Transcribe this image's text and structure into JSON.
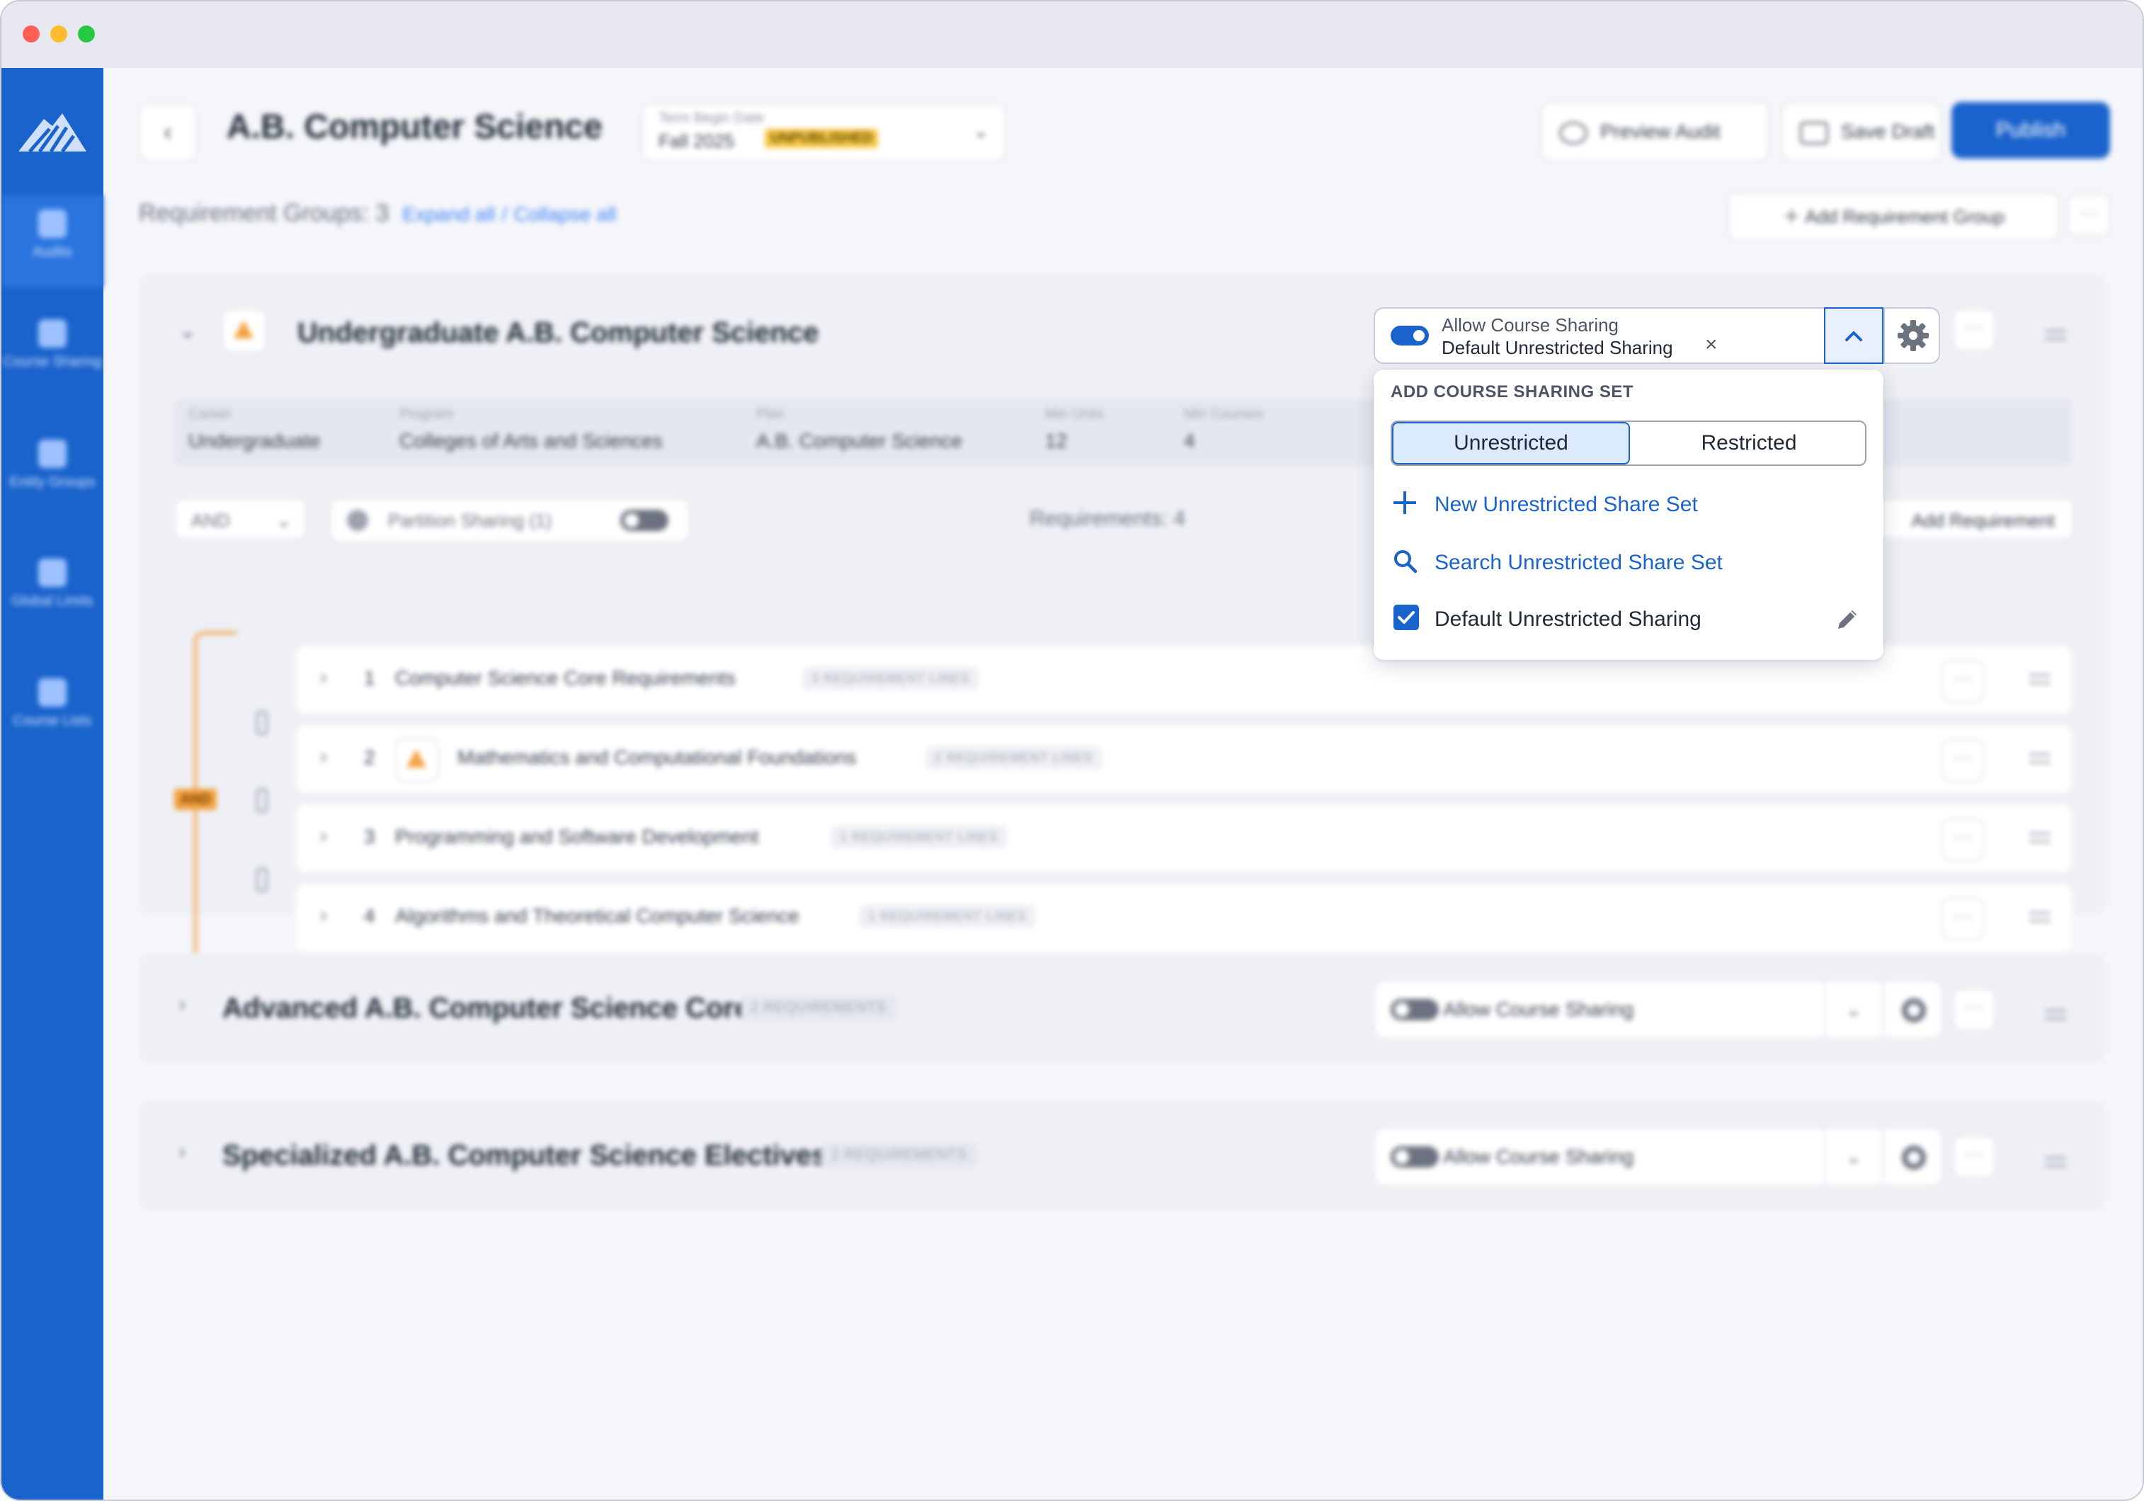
{
  "colors": {
    "brand": "#1a63cc",
    "accent_orange": "#f4a340",
    "badge_yellow": "#f7c948",
    "link": "#1a63cc"
  },
  "sidebar": {
    "items": [
      {
        "label": "Audits",
        "icon": "audit-icon"
      },
      {
        "label": "Course Sharing",
        "icon": "share-icon"
      },
      {
        "label": "Entity Groups",
        "icon": "folder-icon"
      },
      {
        "label": "Global Limits",
        "icon": "lock-icon"
      },
      {
        "label": "Course Lists",
        "icon": "list-icon"
      }
    ]
  },
  "header": {
    "title": "A.B. Computer Science",
    "term_label": "Term Begin Date",
    "term_value": "Fall 2025",
    "term_badge": "UNPUBLISHED",
    "preview_label": "Preview Audit",
    "save_label": "Save Draft",
    "publish_label": "Publish"
  },
  "groups_bar": {
    "count_text": "Requirement Groups: 3",
    "expand_all": "Expand all",
    "separator": "/",
    "collapse_all": "Collapse all",
    "add_group_label": "Add Requirement Group"
  },
  "group1": {
    "title": "Undergraduate A.B. Computer Science",
    "info": [
      {
        "label": "Career",
        "value": "Undergraduate"
      },
      {
        "label": "Program",
        "value": "Colleges of Arts and Sciences"
      },
      {
        "label": "Plan",
        "value": "A.B. Computer Science"
      },
      {
        "label": "Min Units",
        "value": "12"
      },
      {
        "label": "Min Courses",
        "value": "4"
      }
    ],
    "logic_value": "AND",
    "partition_label": "Partition Sharing (1)",
    "requirements_count": "Requirements: 4",
    "add_requirement": "Add Requirement",
    "and_pill": "AND",
    "requirements": [
      {
        "num": "1",
        "name": "Computer Science Core Requirements",
        "lines": "3 REQUIREMENT LINES"
      },
      {
        "num": "2",
        "name": "Mathematics and Computational Foundations",
        "lines": "2 REQUIREMENT LINES"
      },
      {
        "num": "3",
        "name": "Programming and Software Development",
        "lines": "1 REQUIREMENT LINES"
      },
      {
        "num": "4",
        "name": "Algorithms and Theoretical Computer Science",
        "lines": "1 REQUIREMENT LINES"
      }
    ]
  },
  "group2": {
    "title": "Advanced A.B. Computer Science Core",
    "badge": "2 REQUIREMENTS",
    "sharing_label": "Allow Course Sharing"
  },
  "group3": {
    "title": "Specialized A.B. Computer Science Electives",
    "badge": "2 REQUIREMENTS",
    "sharing_label": "Allow Course Sharing"
  },
  "sharing": {
    "title": "Allow Course Sharing",
    "chip": "Default Unrestricted Sharing",
    "enabled": true
  },
  "dropdown": {
    "heading": "ADD COURSE SHARING SET",
    "tab_unrestricted": "Unrestricted",
    "tab_restricted": "Restricted",
    "new_set": "New Unrestricted Share Set",
    "search_set": "Search Unrestricted Share Set",
    "existing_set": "Default Unrestricted Sharing",
    "existing_checked": true
  }
}
